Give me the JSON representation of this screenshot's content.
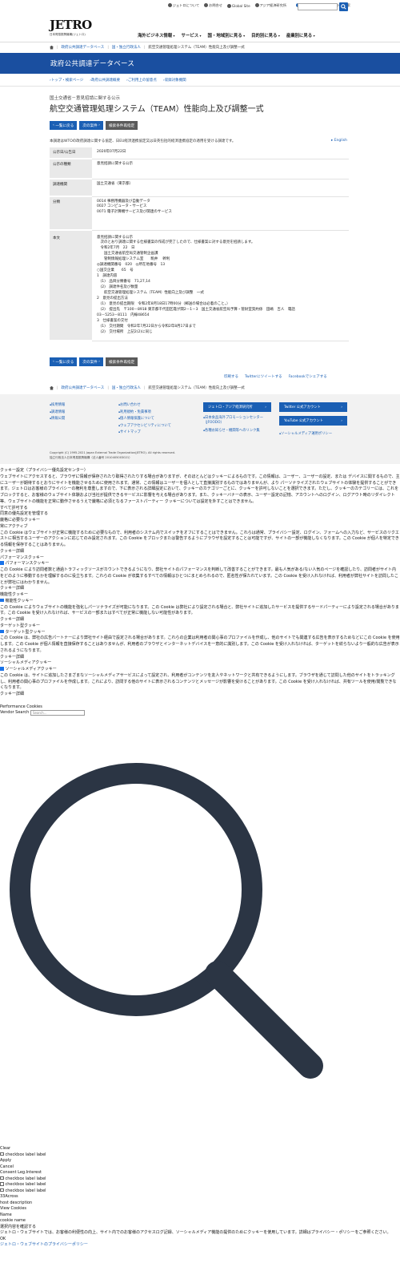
{
  "utility": {
    "links": [
      "ジェトロについて",
      "お問合せ",
      "Global Site",
      "アジア経済研究所"
    ],
    "mypage": "マイページ",
    "search_label": "サイト内検索"
  },
  "logo": {
    "mark": "JETRO",
    "sub": "日本貿易振興機構(ジェトロ)"
  },
  "nav": [
    "海外ビジネス情報",
    "サービス",
    "国・地域別に見る",
    "目的別に見る",
    "産業別に見る"
  ],
  "breadcrumb_top": [
    "政府公共調達データベース",
    "国・独立行政法人",
    "航空交通管理処理システム（TEAM）性能向上及び調整一式"
  ],
  "banner_title": "政府公共調達データベース",
  "subnav": [
    "トップ・検索ページ",
    "政府公共調達概要",
    "ご利用上の留意点",
    "収録対象機関"
  ],
  "caption": "国土交通省－意見招請に関する公示",
  "title": "航空交通管理処理システム（TEAM）性能向上及び調整一式",
  "buttons": {
    "back": "一覧に戻る",
    "next": "次の案件",
    "refine": "検索条件再指定"
  },
  "notice": "本調達はWTOの政府調達に関する協定、日EU経済連携協定又は日英包括的経済連携協定の適用を受ける調達です。",
  "english": "English",
  "table": {
    "labels": [
      "公示日/公告日",
      "公示の種類",
      "調達機関",
      "分類",
      "本文"
    ],
    "date": "2020年07月22日",
    "kind": "意見招請に関する公示",
    "agency": "国土交通省（東京都）",
    "categories": [
      "0014 事務用機器及び自動データ",
      "0027 コンピュータ・サービス",
      "0071 電子計算機サービス及び関連のサービス"
    ],
    "body_lines": [
      "意見招請に関する公示",
      "　次のとおり調達に関する仕様書案の作成が完了したので、仕様書案に対する意見を招請します。",
      "　令和2年7月　22　日",
      "　　国土交通省航空局交通管制企画課",
      "　　管制情報処理システム室　　駒井　 幹利",
      "◎調達機関番号　020　◎所在地番号　13",
      "○国交企業　　65　号",
      "1　調達内容",
      "　(1)　品目分類番号　71,27,14",
      "　(2)　調達件名及び数量",
      "　　航空交通管理処理システム（TEAM）性能向上及び調整　一式",
      "2　意見の提出方法",
      "　(1)　意見の提出期限　令和2年8月18日17時00分（郵送の場合は必着のこと。）",
      "　(2)　提出先　〒100－8918 東京都千代田区霞が関2－1－3　国土交通省航空局予算・管財室契約係　田嶋　吉人　電話",
      "03－5253－8111　内線48654",
      "3　仕様書案の交付",
      "　(1)　交付期間　令和2年7月22日から令和2年8月17日まで",
      "　(2)　交付場所　上記2(2)に同じ"
    ]
  },
  "share": [
    "印刷する",
    "Twitterにツイートする",
    "Facebookでシェアする"
  ],
  "breadcrumb_bottom": [
    "政府公共調達データベース",
    "国・独立行政法人",
    "航空交通管理処理システム（TEAM）性能向上及び調整一式"
  ],
  "footer": {
    "col1": [
      "採用情報",
      "調達情報",
      "情報公開"
    ],
    "col2": [
      "お問い合わせ",
      "利用規約・免責事項",
      "個人情報保護について",
      "ウェブアクセシビリティについて",
      "サイトマップ"
    ],
    "col3_btn": "ジェトロ・アジア経済研究所",
    "col3_links": [
      "日本食品海外プロモーションセンター（JFOODO）",
      "各種お知らせ・機関等へのリンク集"
    ],
    "col4_btns": [
      "Twitter 公式アカウント",
      "YouTube 公式アカウント"
    ],
    "col4_link": "ソーシャルメディア運用ポリシー",
    "copyright": "Copyright (C) 1995-2021 Japan External Trade Organization(JETRO). All rights reserved.",
    "corp": "独立行政法人日本貿易振興機構（法人番号 2010405003021）"
  },
  "cookie": {
    "header": "クッキー設定（プライバシー優先設定センター）",
    "intro": "ウェブサイトにアクセスすると、ブラウザに情報が保存されたり取得されたりする場合がありますが、そのほとんどはクッキーによるものです。この情報は、ユーザー、ユーザーの設定、または デバイスに関するもので、主にユーザーが期待するとおりにサイトを機能させるために使用されます。通常、この情報はユーザーを個人として直接識別するものではありませんが、より パーソナライズされたウェブサイトの体験を提供することができます。ジェトロはお客様のプライバシーの権利を尊重しますので、下に表示される詳細設定において、クッキーのカテゴリーごとに、クッキーを許可しないことを選択できます。ただし、クッキーのカテゴリーには、これをブロックすると、お客様のウェブサイト体験および当社が提供できるサービスに影響を与える場合があります。また、クッキーバナーの表示、ユーザー設定の記憶、アカウントへのログイン、ログアウト時のリダイレクト等、ウェブサイトの機能を正常に動作させるうえで厳格に必須となるファーストパーティー クッキーについては設定を外すことはできません。",
    "allow_all": "すべて許可する",
    "manage": "同意の優先設定を管理する",
    "strict_title": "厳格に必要なクッキー",
    "always_active": "常にアクティブ",
    "strict_desc": "この Cookie はウェブサイトが正常に機能するために必要なもので、利用者のシステム内でスイッチをオフにすることはできません。これらは通常、プライバシー設定、ログイン、フォームへの入力など、サービスのリクエストに相当するユーザーのアクションに応じてのみ設定されます。この Cookie をブロックまたは警告するようにブラウザを設定することは可能ですが、サイトの一部が機能しなくなります。この Cookie が個人を特定できる情報を保存することはありません。",
    "details": "クッキー詳細",
    "perf_title": "パフォーマンスクッキー",
    "perf_cb": "パフォーマンスクッキー",
    "perf_desc": "この Cookie により訪問者数と通過トラフィックソースがカウントできるようになり、弊社サイトのパフォーマンスを判断して改善することができます。最も人気がある/ない人気のページを確認したり、訪問者がサイト内をどのように移動するかを理解するのに役立ちます。これらの Cookie が収集するすべての情報はひとつにまとめられるので、匿名性が保たれています。この Cookie を受け入れなければ、利用者が弊社サイトを訪問したことが弊社にはわかりません。",
    "func_title": "機能性クッキー",
    "func_cb": "機能性クッキー",
    "func_desc": "この Cookie によりウェブサイトの機能を強化しパーソナライズが可能になります。この Cookie は弊社により設定される場合と、弊社サイトに追加したサービスを提供するサードパーティーにより設定される場合があります。この Cookie を受け入れなければ、サービスの一部またはすべてが正常に機能しない可能性があります。",
    "target_title": "ターゲット型クッキー",
    "target_cb": "ターゲット型クッキー",
    "target_desc": "この Cookie は、弊社の広告パートナーにより弊社サイト経由で設定される場合があります。これらの企業は利用者の関心事のプロファイルを作成し、他のサイトでも関連する広告を表示するためなどにこの Cookie を使用します。この Cookie が個人情報を直接保存することはありませんが、利用者のブラウザとインターネットデバイスを一意的に識別します。この Cookie を受け入れなければ、ターゲットを絞らないより一般的な広告が表示されるようになります。",
    "social_title": "ソーシャルメディアクッキー",
    "social_cb": "ソーシャルメディアクッキー",
    "social_desc": "この Cookie は、サイトに追加したさまざまなソーシャルメディアサービスによって設定され、利用者がコンテンツを友人やネットワークと共有できるようにします。ブラウザを通じて訪問した他のサイトをトラッキングし、利用者の関心事のプロファイルを作成します。これにより、訪問する他のサイトに表示されるコンテンツとメッセージが影響を受けることがあります。この Cookie を受け入れなければ、共有ツールを使用/閲覧できなくなります。",
    "perf_cookies": "Performance Cookies",
    "vendor_search": "Vendor Search",
    "search_placeholder": "Search...",
    "clear": "Clear",
    "cb_label": "checkbox label label",
    "apply": "Apply",
    "cancel": "Cancel",
    "consent": "Consent Leg.Interest",
    "across": "33Across",
    "host_desc": "host description",
    "view_cookies": "View Cookies",
    "name": "Name",
    "cookie_name": "cookie name",
    "confirm": "選択内容を確認する",
    "footnote": "ジェトロ・ウェブサイトでは、お客様の利便性の向上、サイト内でのお客様のアクセスログ記録、ソーシャルメディア機能の提供のためにクッキーを使用しています。詳細はプライバシー・ポリシーをご参照ください。",
    "ok": "OK",
    "policy_link": "ジェトロ・ウェブサイトのプライバシーポリシー"
  }
}
